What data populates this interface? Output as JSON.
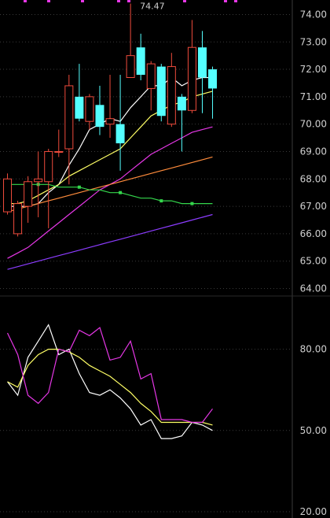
{
  "chart_data": [
    {
      "type": "candlestick",
      "ylim": [
        63.9,
        74.3
      ],
      "y_ticks": [
        "74.00",
        "73.00",
        "72.00",
        "71.00",
        "70.00",
        "69.00",
        "68.00",
        "67.00",
        "66.00",
        "65.00",
        "64.00"
      ],
      "high_label": "74.47",
      "up_color": "#ef4b3c",
      "down_color": "#54ffff",
      "candles": [
        {
          "open": 66.8,
          "close": 68.0,
          "high": 68.2,
          "low": 66.7
        },
        {
          "open": 66.0,
          "close": 67.1,
          "high": 67.2,
          "low": 65.9
        },
        {
          "open": 67.0,
          "close": 67.9,
          "high": 68.1,
          "low": 66.4
        },
        {
          "open": 67.9,
          "close": 68.0,
          "high": 69.0,
          "low": 66.6
        },
        {
          "open": 67.9,
          "close": 69.0,
          "high": 69.1,
          "low": 66.2
        },
        {
          "open": 69.0,
          "close": 69.0,
          "high": 69.8,
          "low": 68.8
        },
        {
          "open": 69.1,
          "close": 71.4,
          "high": 71.8,
          "low": 67.8
        },
        {
          "open": 71.0,
          "close": 70.2,
          "high": 72.2,
          "low": 70.1
        },
        {
          "open": 70.1,
          "close": 71.0,
          "high": 71.1,
          "low": 69.8
        },
        {
          "open": 70.7,
          "close": 69.9,
          "high": 71.4,
          "low": 69.6
        },
        {
          "open": 70.0,
          "close": 70.2,
          "high": 71.8,
          "low": 69.5
        },
        {
          "open": 70.0,
          "close": 69.3,
          "high": 71.8,
          "low": 68.3
        },
        {
          "open": 71.7,
          "close": 72.5,
          "high": 74.4,
          "low": 71.7
        },
        {
          "open": 72.8,
          "close": 71.8,
          "high": 73.3,
          "low": 71.6
        },
        {
          "open": 71.3,
          "close": 72.2,
          "high": 72.3,
          "low": 70.5
        },
        {
          "open": 72.1,
          "close": 70.3,
          "high": 72.2,
          "low": 70.1
        },
        {
          "open": 70.0,
          "close": 72.1,
          "high": 72.6,
          "low": 69.9
        },
        {
          "open": 71.0,
          "close": 70.5,
          "high": 71.1,
          "low": 69.0
        },
        {
          "open": 70.5,
          "close": 72.8,
          "high": 73.8,
          "low": 70.4
        },
        {
          "open": 72.8,
          "close": 71.7,
          "high": 73.4,
          "low": 70.4
        },
        {
          "open": 72.0,
          "close": 71.3,
          "high": 72.1,
          "low": 70.2
        }
      ],
      "moving_averages": [
        {
          "color": "#ffffff",
          "values": [
            67.0,
            67.0,
            67.0,
            67.1,
            67.5,
            67.8,
            68.5,
            69.1,
            69.8,
            70.0,
            70.2,
            70.1,
            70.6,
            71.0,
            71.4,
            71.4,
            71.7,
            71.4,
            71.6,
            71.7,
            71.7
          ]
        },
        {
          "color": "#ffff66",
          "values": [
            67.1,
            67.1,
            67.2,
            67.4,
            67.6,
            67.8,
            68.1,
            68.3,
            68.5,
            68.7,
            68.9,
            69.1,
            69.5,
            69.9,
            70.3,
            70.5,
            70.7,
            70.8,
            71.0,
            71.1,
            71.2
          ]
        },
        {
          "color": "#e637e6",
          "values": [
            65.1,
            65.3,
            65.5,
            65.8,
            66.1,
            66.4,
            66.7,
            67.0,
            67.3,
            67.6,
            67.8,
            68.0,
            68.3,
            68.6,
            68.9,
            69.1,
            69.3,
            69.5,
            69.7,
            69.8,
            69.9
          ]
        },
        {
          "color": "#ff8c3c",
          "values": [
            66.8,
            66.9,
            67.0,
            67.1,
            67.2,
            67.3,
            67.4,
            67.5,
            67.6,
            67.7,
            67.8,
            67.9,
            68.0,
            68.1,
            68.2,
            68.3,
            68.4,
            68.5,
            68.6,
            68.7,
            68.8
          ]
        },
        {
          "color": "#34d64c",
          "values": [
            67.8,
            67.8,
            67.8,
            67.8,
            67.8,
            67.7,
            67.7,
            67.7,
            67.6,
            67.6,
            67.5,
            67.5,
            67.4,
            67.3,
            67.3,
            67.2,
            67.2,
            67.1,
            67.1,
            67.1,
            67.1
          ]
        },
        {
          "color": "#8c3cff",
          "values": [
            64.7,
            64.8,
            64.9,
            65.0,
            65.1,
            65.2,
            65.3,
            65.4,
            65.5,
            65.6,
            65.7,
            65.8,
            65.9,
            66.0,
            66.1,
            66.2,
            66.3,
            66.4,
            66.5,
            66.6,
            66.7
          ]
        }
      ]
    },
    {
      "type": "line",
      "ylim": [
        20,
        95
      ],
      "y_ticks": [
        "80.00",
        "50.00",
        "20.00"
      ],
      "series": [
        {
          "color": "#ffffff",
          "values": [
            68,
            63,
            77,
            83,
            89,
            78,
            80,
            71,
            64,
            63,
            65,
            62,
            58,
            52,
            54,
            47,
            47,
            48,
            53,
            52,
            50
          ]
        },
        {
          "color": "#ffff66",
          "values": [
            68,
            66,
            74,
            78,
            80,
            80,
            79,
            77,
            74,
            72,
            70,
            67,
            64,
            60,
            57,
            53,
            53,
            53,
            53,
            53,
            52
          ]
        },
        {
          "color": "#e637e6",
          "values": [
            86,
            78,
            63,
            60,
            64,
            80,
            79,
            87,
            85,
            88,
            76,
            77,
            83,
            69,
            71,
            54,
            54,
            54,
            53,
            53,
            58
          ]
        }
      ]
    }
  ]
}
